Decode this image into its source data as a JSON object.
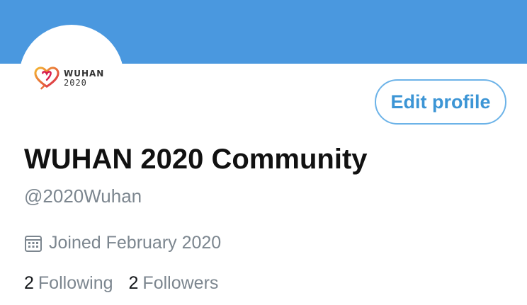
{
  "profile": {
    "avatar": {
      "logo_line1": "WUHAN",
      "logo_line2": "2020"
    },
    "edit_button_label": "Edit profile",
    "display_name": "WUHAN 2020 Community",
    "handle": "@2020Wuhan",
    "joined": "Joined February 2020",
    "following_count": "2",
    "following_label": "Following",
    "followers_count": "2",
    "followers_label": "Followers"
  },
  "icons": {
    "calendar": "calendar-icon",
    "logo": "heart-logo-icon"
  },
  "colors": {
    "banner": "#4a98df",
    "accent": "#3c95d5",
    "secondary_text": "#7c868f",
    "primary_text": "#111111"
  }
}
